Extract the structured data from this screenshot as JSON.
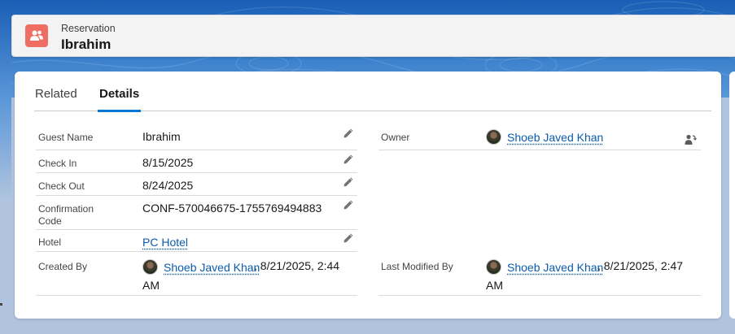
{
  "header": {
    "object_label": "Reservation",
    "record_name": "Ibrahim",
    "icon": "reservation-people-icon",
    "icon_color": "#ef6e64"
  },
  "tabs": [
    {
      "label": "Related",
      "active": false
    },
    {
      "label": "Details",
      "active": true
    }
  ],
  "accent_color": "#0176d3",
  "link_color": "#0b5cab",
  "fields": {
    "guest_name": {
      "label": "Guest Name",
      "value": "Ibrahim"
    },
    "check_in": {
      "label": "Check In",
      "value": "8/15/2025"
    },
    "check_out": {
      "label": "Check Out",
      "value": "8/24/2025"
    },
    "confirmation_code": {
      "label_line1": "Confirmation",
      "label_line2": "Code",
      "value": "CONF-570046675-1755769494883"
    },
    "hotel": {
      "label": "Hotel",
      "value": "PC Hotel"
    },
    "created_by": {
      "label": "Created By",
      "user": "Shoeb Javed Khan",
      "date_part1": ", 8/21/2025, 2:44",
      "date_part2": "AM"
    },
    "owner": {
      "label": "Owner",
      "user": "Shoeb Javed Khan"
    },
    "last_modified_by": {
      "label": "Last Modified By",
      "user": "Shoeb Javed Khan",
      "date_part1": ", 8/21/2025, 2:47",
      "date_part2": "AM"
    }
  }
}
